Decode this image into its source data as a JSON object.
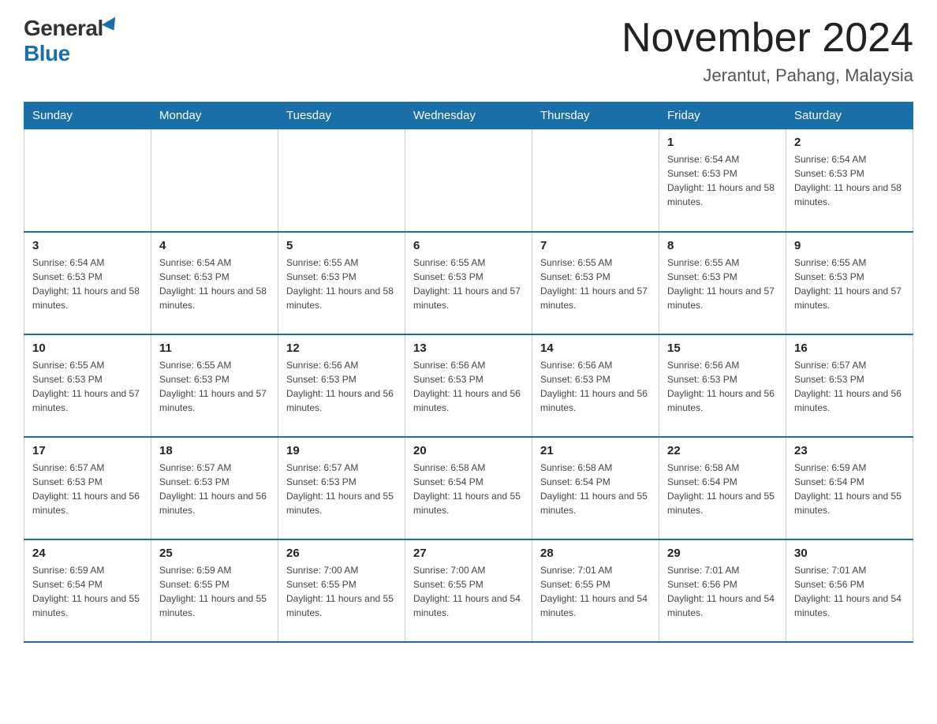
{
  "logo": {
    "general": "General",
    "blue": "Blue"
  },
  "title": "November 2024",
  "subtitle": "Jerantut, Pahang, Malaysia",
  "days_of_week": [
    "Sunday",
    "Monday",
    "Tuesday",
    "Wednesday",
    "Thursday",
    "Friday",
    "Saturday"
  ],
  "weeks": [
    [
      {
        "day": "",
        "info": ""
      },
      {
        "day": "",
        "info": ""
      },
      {
        "day": "",
        "info": ""
      },
      {
        "day": "",
        "info": ""
      },
      {
        "day": "",
        "info": ""
      },
      {
        "day": "1",
        "info": "Sunrise: 6:54 AM\nSunset: 6:53 PM\nDaylight: 11 hours and 58 minutes."
      },
      {
        "day": "2",
        "info": "Sunrise: 6:54 AM\nSunset: 6:53 PM\nDaylight: 11 hours and 58 minutes."
      }
    ],
    [
      {
        "day": "3",
        "info": "Sunrise: 6:54 AM\nSunset: 6:53 PM\nDaylight: 11 hours and 58 minutes."
      },
      {
        "day": "4",
        "info": "Sunrise: 6:54 AM\nSunset: 6:53 PM\nDaylight: 11 hours and 58 minutes."
      },
      {
        "day": "5",
        "info": "Sunrise: 6:55 AM\nSunset: 6:53 PM\nDaylight: 11 hours and 58 minutes."
      },
      {
        "day": "6",
        "info": "Sunrise: 6:55 AM\nSunset: 6:53 PM\nDaylight: 11 hours and 57 minutes."
      },
      {
        "day": "7",
        "info": "Sunrise: 6:55 AM\nSunset: 6:53 PM\nDaylight: 11 hours and 57 minutes."
      },
      {
        "day": "8",
        "info": "Sunrise: 6:55 AM\nSunset: 6:53 PM\nDaylight: 11 hours and 57 minutes."
      },
      {
        "day": "9",
        "info": "Sunrise: 6:55 AM\nSunset: 6:53 PM\nDaylight: 11 hours and 57 minutes."
      }
    ],
    [
      {
        "day": "10",
        "info": "Sunrise: 6:55 AM\nSunset: 6:53 PM\nDaylight: 11 hours and 57 minutes."
      },
      {
        "day": "11",
        "info": "Sunrise: 6:55 AM\nSunset: 6:53 PM\nDaylight: 11 hours and 57 minutes."
      },
      {
        "day": "12",
        "info": "Sunrise: 6:56 AM\nSunset: 6:53 PM\nDaylight: 11 hours and 56 minutes."
      },
      {
        "day": "13",
        "info": "Sunrise: 6:56 AM\nSunset: 6:53 PM\nDaylight: 11 hours and 56 minutes."
      },
      {
        "day": "14",
        "info": "Sunrise: 6:56 AM\nSunset: 6:53 PM\nDaylight: 11 hours and 56 minutes."
      },
      {
        "day": "15",
        "info": "Sunrise: 6:56 AM\nSunset: 6:53 PM\nDaylight: 11 hours and 56 minutes."
      },
      {
        "day": "16",
        "info": "Sunrise: 6:57 AM\nSunset: 6:53 PM\nDaylight: 11 hours and 56 minutes."
      }
    ],
    [
      {
        "day": "17",
        "info": "Sunrise: 6:57 AM\nSunset: 6:53 PM\nDaylight: 11 hours and 56 minutes."
      },
      {
        "day": "18",
        "info": "Sunrise: 6:57 AM\nSunset: 6:53 PM\nDaylight: 11 hours and 56 minutes."
      },
      {
        "day": "19",
        "info": "Sunrise: 6:57 AM\nSunset: 6:53 PM\nDaylight: 11 hours and 55 minutes."
      },
      {
        "day": "20",
        "info": "Sunrise: 6:58 AM\nSunset: 6:54 PM\nDaylight: 11 hours and 55 minutes."
      },
      {
        "day": "21",
        "info": "Sunrise: 6:58 AM\nSunset: 6:54 PM\nDaylight: 11 hours and 55 minutes."
      },
      {
        "day": "22",
        "info": "Sunrise: 6:58 AM\nSunset: 6:54 PM\nDaylight: 11 hours and 55 minutes."
      },
      {
        "day": "23",
        "info": "Sunrise: 6:59 AM\nSunset: 6:54 PM\nDaylight: 11 hours and 55 minutes."
      }
    ],
    [
      {
        "day": "24",
        "info": "Sunrise: 6:59 AM\nSunset: 6:54 PM\nDaylight: 11 hours and 55 minutes."
      },
      {
        "day": "25",
        "info": "Sunrise: 6:59 AM\nSunset: 6:55 PM\nDaylight: 11 hours and 55 minutes."
      },
      {
        "day": "26",
        "info": "Sunrise: 7:00 AM\nSunset: 6:55 PM\nDaylight: 11 hours and 55 minutes."
      },
      {
        "day": "27",
        "info": "Sunrise: 7:00 AM\nSunset: 6:55 PM\nDaylight: 11 hours and 54 minutes."
      },
      {
        "day": "28",
        "info": "Sunrise: 7:01 AM\nSunset: 6:55 PM\nDaylight: 11 hours and 54 minutes."
      },
      {
        "day": "29",
        "info": "Sunrise: 7:01 AM\nSunset: 6:56 PM\nDaylight: 11 hours and 54 minutes."
      },
      {
        "day": "30",
        "info": "Sunrise: 7:01 AM\nSunset: 6:56 PM\nDaylight: 11 hours and 54 minutes."
      }
    ]
  ]
}
